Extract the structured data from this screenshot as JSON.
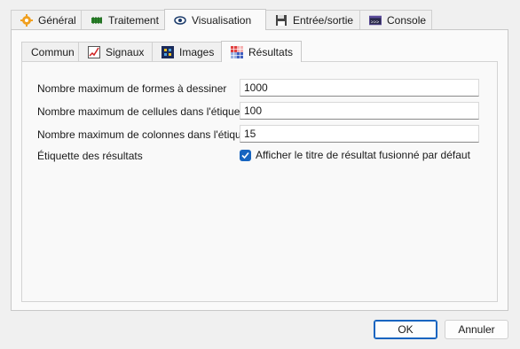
{
  "tabs": [
    {
      "label": "Général",
      "icon": "gear-icon"
    },
    {
      "label": "Traitement",
      "icon": "processor-icon"
    },
    {
      "label": "Visualisation",
      "icon": "eye-icon"
    },
    {
      "label": "Entrée/sortie",
      "icon": "floppy-disk-icon"
    },
    {
      "label": "Console",
      "icon": "console-icon"
    }
  ],
  "active_tab": "Visualisation",
  "subtabs": [
    {
      "label": "Commun",
      "icon": ""
    },
    {
      "label": "Signaux",
      "icon": "signal-icon"
    },
    {
      "label": "Images",
      "icon": "image-icon"
    },
    {
      "label": "Résultats",
      "icon": "results-grid-icon"
    }
  ],
  "active_subtab": "Résultats",
  "fields": {
    "max_shapes": {
      "label": "Nombre maximum de formes à dessiner",
      "value": "1000"
    },
    "max_cells": {
      "label": "Nombre maximum de cellules dans l'étiquette",
      "value": "100"
    },
    "max_columns": {
      "label": "Nombre maximum de colonnes dans l'étiquette",
      "value": "15"
    },
    "result_label": {
      "label": "Étiquette des résultats",
      "checkbox_label": "Afficher le titre de résultat fusionné par défaut",
      "checked": true
    }
  },
  "buttons": {
    "ok": "OK",
    "cancel": "Annuler"
  },
  "colors": {
    "accent": "#1664c0",
    "icon_orange": "#f0a020",
    "icon_green": "#2e8b2e"
  }
}
